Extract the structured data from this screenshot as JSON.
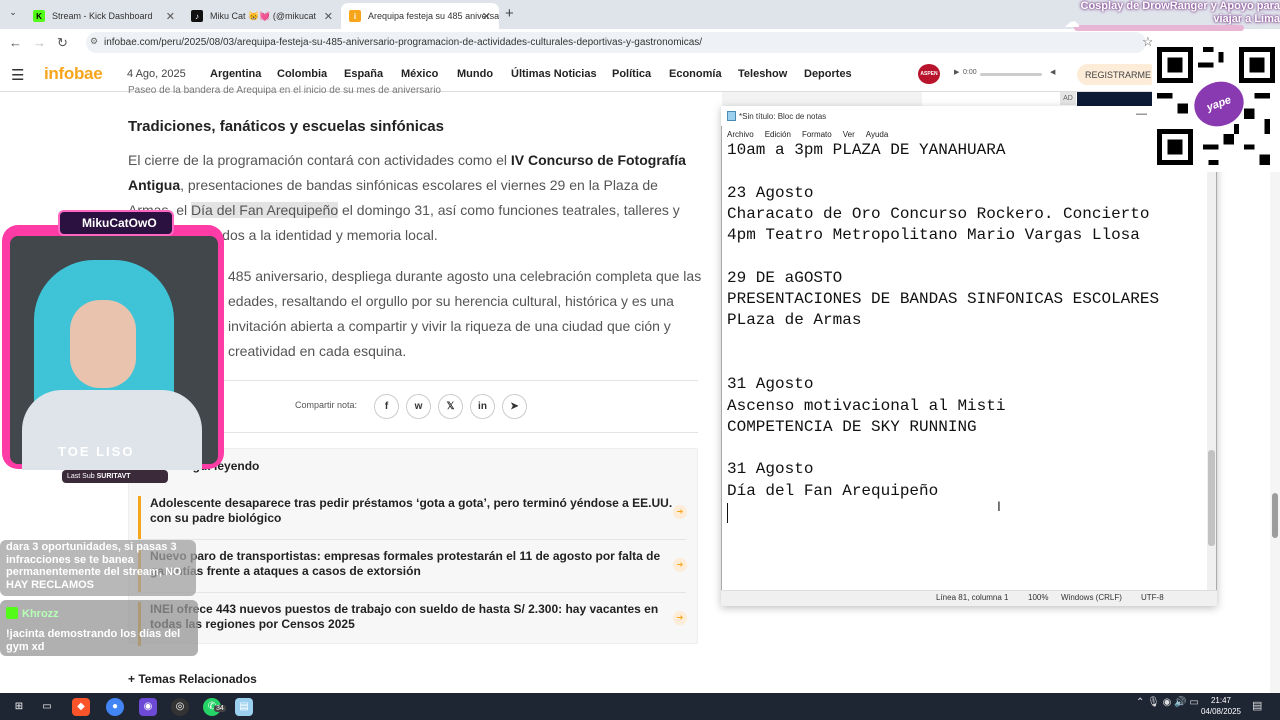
{
  "browser": {
    "tabs": [
      {
        "label": "Stream - Kick Dashboard",
        "icon": "kick-icon"
      },
      {
        "label": "Miku Cat 😸💓 (@mikucat",
        "icon": "tiktok-icon"
      },
      {
        "label": "Arequipa festeja su 485 aniversa",
        "icon": "infobae-icon"
      }
    ],
    "url": "infobae.com/peru/2025/08/03/arequipa-festeja-su-485-aniversario-programacion-de-actividades-culturales-deportivas-y-gastronomicas/"
  },
  "site": {
    "logo": "infobae",
    "date": "4 Ago, 2025",
    "nav": [
      "Argentina",
      "Colombia",
      "España",
      "México",
      "Mundo",
      "Últimas Noticias",
      "Política",
      "Economía",
      "Teleshow",
      "Deportes"
    ],
    "player_time": "0:00",
    "register": "REGISTRARME",
    "ad_label": "AD"
  },
  "article": {
    "caption": "Paseo de la bandera de Arequipa en el inicio de su mes de aniversario",
    "heading": "Tradiciones, fanáticos y escuelas sinfónicas",
    "p1": {
      "a": "El cierre de la programación contará con actividades como el ",
      "b": "IV Concurso de Fotografía Antigua",
      "c": ", presentaciones de bandas sinfónicas escolares el viernes 29 en la Plaza de Armas, el ",
      "d": "Día del Fan Arequipeño",
      "e": " el domingo 31, así como funciones teatrales, talleres y eventos dedicados a la identidad y memoria local."
    },
    "p2": "485 aniversario, despliega durante agosto una celebración completa que las edades, resaltando el orgullo por su herencia cultural, histórica y es una invitación abierta a compartir y vivir la riqueza de una ciudad que ción y creatividad en cada esquina.",
    "share_label": "Compartir nota:",
    "share": [
      "f",
      "w",
      "𝕏",
      "in",
      "➤"
    ],
    "reading_title": "Seguí leyendo",
    "reading": [
      "Adolescente desaparece tras pedir préstamos ‘gota a gota’, pero terminó yéndose a EE.UU. con su padre biológico",
      "Nuevo paro de transportistas: empresas formales protestarán el 11 de agosto por falta de garantías frente a ataques a casos de extorsión",
      "INEI ofrece 443 nuevos puestos de trabajo con sueldo de hasta S/ 2.300: hay vacantes en todas las regiones por Censos 2025"
    ],
    "temas": "Temas Relacionados",
    "temas_plus": "+"
  },
  "notepad": {
    "title": "*Sin título: Bloc de notas",
    "menu": [
      "Archivo",
      "Edición",
      "Formato",
      "Ver",
      "Ayuda"
    ],
    "text": "10am a 3pm PLAZA DE YANAHUARA\n\n23 Agosto\nCharacato de Oro Concurso Rockero. Concierto\n4pm Teatro Metropolitano Mario Vargas Llosa\n\n29 DE aGOSTO\nPRESENTACIONES DE BANDAS SINFONICAS ESCOLARES\nPLaza de Armas\n\n\n31 Agosto\nAscenso motivacional al Misti\nCOMPETENCIA DE SKY RUNNING\n\n31 Agosto\nDía del Fan Arequipeño",
    "status": {
      "pos": "Línea 81, columna 1",
      "zoom": "100%",
      "eol": "Windows (CRLF)",
      "enc": "UTF-8"
    }
  },
  "overlay": {
    "banner": "Cosplay de DrowRanger y Apoyo para viajar a Lima",
    "qr_badge": "yape",
    "cam_name": "MikuCatOwO",
    "cam_text": "TOE LISO",
    "last_sub_label": "Last Sub",
    "last_sub_name": "SURITAVT",
    "chat1": "dara 3 oportunidades, si pasas 3 infracciones se te banea permanentemente del stream, NO HAY RECLAMOS",
    "chat2_user": "Khrozz",
    "chat2_msg": "!jacinta demostrando los días del gym xd"
  },
  "taskbar": {
    "time": "21:47",
    "date": "04/08/2025",
    "badge": "34"
  }
}
